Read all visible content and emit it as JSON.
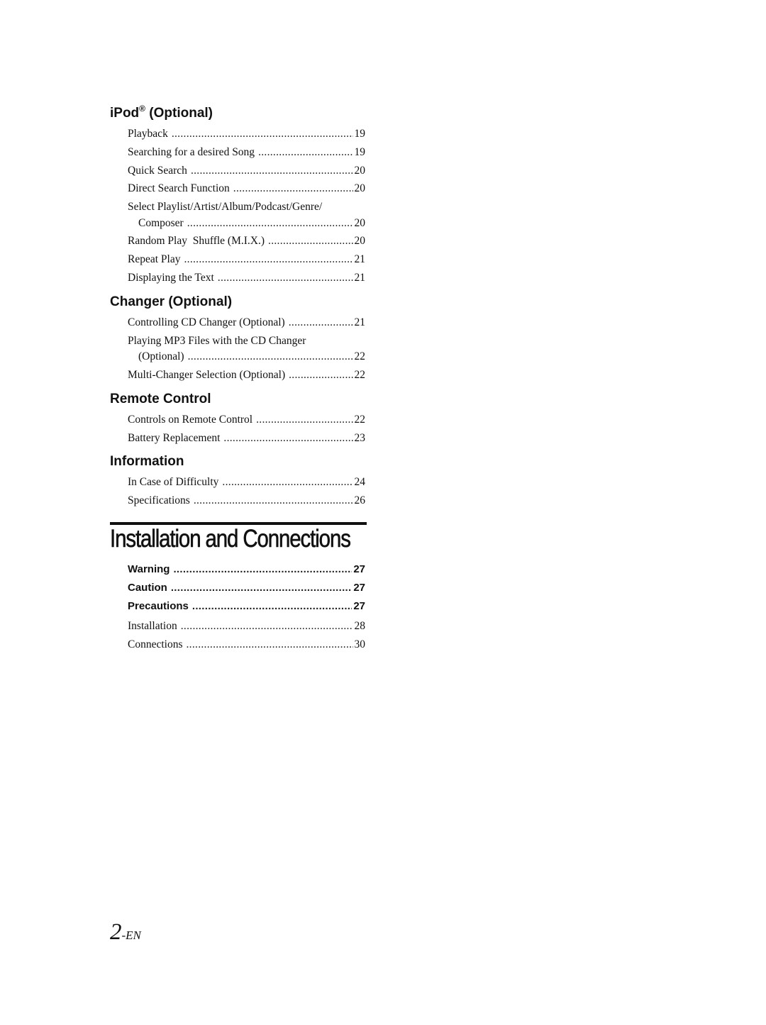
{
  "sections": [
    {
      "heading": "iPod",
      "heading_sup": "®",
      "heading_rest": " (Optional)",
      "entries": [
        {
          "label": "Playback",
          "page": "19"
        },
        {
          "label": "Searching for a desired Song",
          "page": "19"
        },
        {
          "label": "Quick Search",
          "page": "20"
        },
        {
          "label": "Direct Search Function",
          "page": "20"
        },
        {
          "label": "Select Playlist/Artist/Album/Podcast/Genre/",
          "continuation": "Composer",
          "page": "20"
        },
        {
          "label": "Random Play  Shuffle (M.I.X.)",
          "page": "20"
        },
        {
          "label": "Repeat Play",
          "page": "21"
        },
        {
          "label": "Displaying the Text",
          "page": "21"
        }
      ]
    },
    {
      "heading": "Changer (Optional)",
      "entries": [
        {
          "label": "Controlling CD Changer (Optional)",
          "page": "21"
        },
        {
          "label": "Playing MP3 Files with the CD Changer",
          "continuation": "(Optional)",
          "page": "22"
        },
        {
          "label": "Multi-Changer Selection (Optional)",
          "page": "22"
        }
      ]
    },
    {
      "heading": "Remote Control",
      "entries": [
        {
          "label": "Controls on Remote Control",
          "page": "22"
        },
        {
          "label": "Battery Replacement",
          "page": "23"
        }
      ]
    },
    {
      "heading": "Information",
      "entries": [
        {
          "label": "In Case of Difficulty",
          "page": "24"
        },
        {
          "label": "Specifications",
          "page": "26"
        }
      ]
    }
  ],
  "chapter": {
    "title": "Installation and Connections",
    "entries": [
      {
        "label": "Warning",
        "page": "27",
        "bold": true
      },
      {
        "label": "Caution",
        "page": "27",
        "bold": true
      },
      {
        "label": "Precautions",
        "page": "27",
        "bold": true
      },
      {
        "label": "Installation",
        "page": "28"
      },
      {
        "label": "Connections",
        "page": "30"
      }
    ]
  },
  "footer": {
    "page_number": "2",
    "page_suffix": "-EN"
  }
}
